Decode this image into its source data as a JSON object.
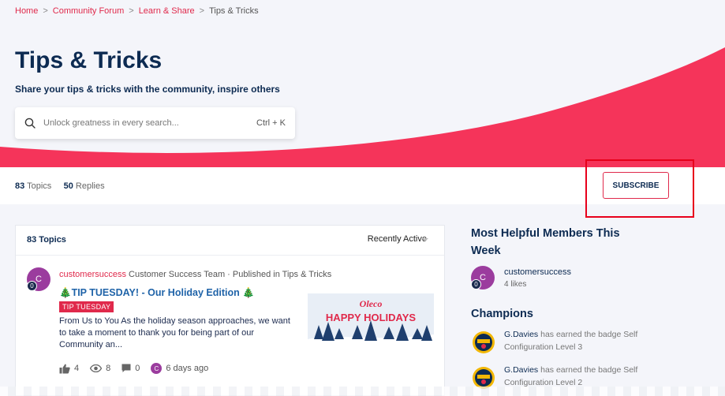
{
  "breadcrumb": {
    "items": [
      "Home",
      "Community Forum",
      "Learn & Share"
    ],
    "current": "Tips & Tricks",
    "separator": ">"
  },
  "header": {
    "title": "Tips & Tricks",
    "subtitle": "Share your tips & tricks with the community, inspire others"
  },
  "search": {
    "placeholder": "Unlock greatness in every search...",
    "shortcut": "Ctrl + K"
  },
  "stats": {
    "topics_count": "83",
    "topics_label": "Topics",
    "replies_count": "50",
    "replies_label": "Replies"
  },
  "subscribe_label": "SUBSCRIBE",
  "topics_panel": {
    "header": "83 Topics",
    "sort_label": "Recently Active"
  },
  "post": {
    "avatar_initial": "C",
    "avatar_badge": "0",
    "author": "customersuccess",
    "meta": "Customer Success Team · Published in Tips & Tricks",
    "title": "🎄TIP TUESDAY! - Our Holiday Edition 🎄",
    "tag": "TIP TUESDAY",
    "excerpt": "From Us to You As the holiday season approaches, we want to take a moment to thank you for being part of our Community an...",
    "likes": "4",
    "views": "8",
    "replies": "0",
    "last_avatar_initial": "C",
    "time": "6 days ago",
    "thumb_brand": "Oleco",
    "thumb_text": "HAPPY HOLIDAYS"
  },
  "sidebar": {
    "helpful_title": "Most Helpful Members This Week",
    "member": {
      "initial": "C",
      "badge": "0",
      "name": "customersuccess",
      "likes": "4 likes"
    },
    "champions_title": "Champions",
    "champions": [
      {
        "name": "G.Davies",
        "text": "has earned the badge Self Configuration Level 3"
      },
      {
        "name": "G.Davies",
        "text": "has earned the badge Self Configuration Level 2"
      }
    ]
  },
  "colors": {
    "accent": "#e0294b",
    "navy": "#0d2b52",
    "link": "#1f63a8"
  }
}
